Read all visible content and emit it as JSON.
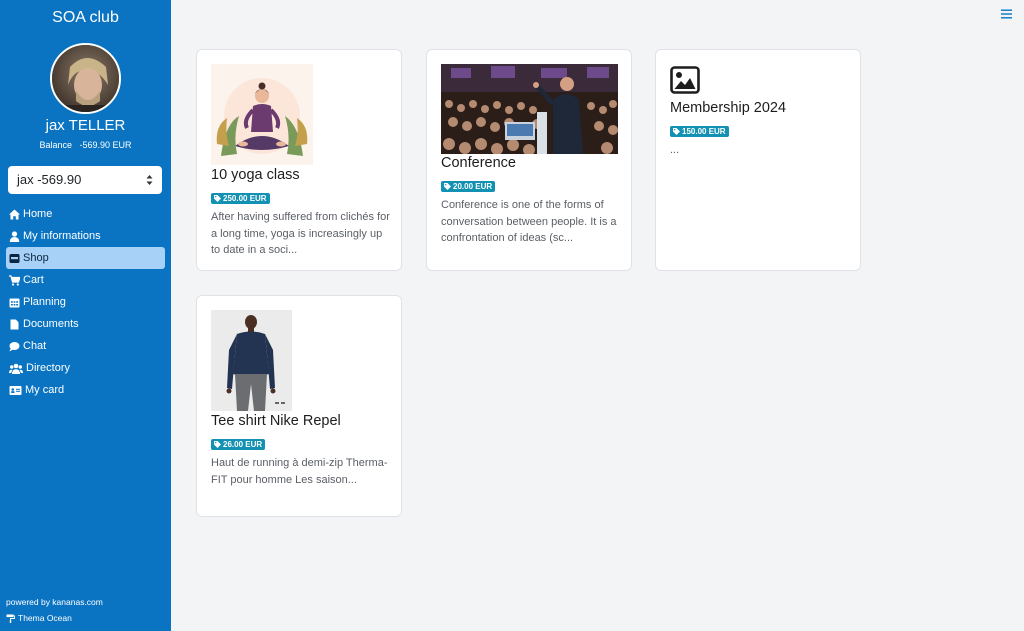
{
  "sidebar": {
    "club_name": "SOA club",
    "user_name": "jax TELLER",
    "balance_label": "Balance",
    "balance_value": "-569.90 EUR",
    "balance_select_value": "jax -569.90",
    "nav_items": [
      {
        "label": "Home",
        "icon": "home-icon"
      },
      {
        "label": "My informations",
        "icon": "user-icon"
      },
      {
        "label": "Shop",
        "icon": "store-icon",
        "active": true
      },
      {
        "label": "Cart",
        "icon": "cart-icon"
      },
      {
        "label": "Planning",
        "icon": "calendar-icon"
      },
      {
        "label": "Documents",
        "icon": "document-icon"
      },
      {
        "label": "Chat",
        "icon": "chat-icon"
      },
      {
        "label": "Directory",
        "icon": "users-icon"
      },
      {
        "label": "My card",
        "icon": "id-card-icon"
      }
    ],
    "powered_by": "powered by kananas.com",
    "theme": "Thema Ocean"
  },
  "products": [
    {
      "title": "10 yoga class",
      "price": "250.00 EUR",
      "description": "After having suffered from clichés for a long time, yoga is increasingly up to date in a soci...",
      "image": "yoga-illustration"
    },
    {
      "title": "Conference",
      "price": "20.00 EUR",
      "description": "Conference is one of the forms of conversation between people. It is a confrontation of ideas (sc...",
      "image": "conference-photo"
    },
    {
      "title": "Membership 2024",
      "price": "150.00 EUR",
      "description": "...",
      "image": "image-placeholder-icon"
    },
    {
      "title": "Tee shirt Nike Repel",
      "price": "26.00 EUR",
      "description": "Haut de running à demi-zip Therma-FIT pour homme Les saison...",
      "image": "tee-shirt-photo"
    }
  ],
  "colors": {
    "sidebar_bg": "#0a74c2",
    "active_nav_bg": "#a7d1f7",
    "badge_bg": "#1391b3",
    "page_bg": "#f3f4f6"
  }
}
